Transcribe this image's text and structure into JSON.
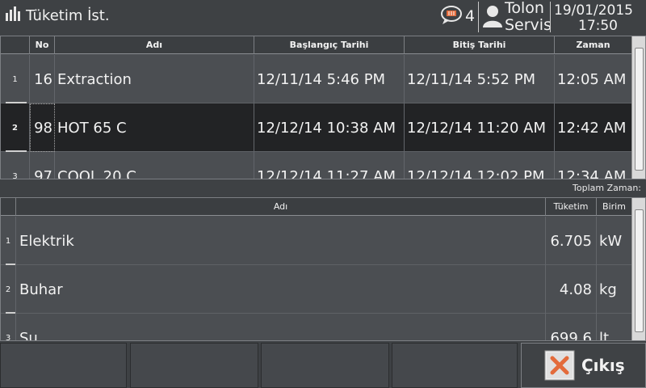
{
  "header": {
    "title": "Tüketim İst.",
    "message_count": "4",
    "user_line1": "Tolon",
    "user_line2": "Servis",
    "date": "19/01/2015",
    "time": "17:50"
  },
  "process_table": {
    "columns": [
      "No",
      "Adı",
      "Başlangıç Tarihi",
      "Bitiş Tarihi",
      "Zaman"
    ],
    "rows": [
      {
        "index": "1",
        "no": "16",
        "name": "Extraction",
        "start": "12/11/14 5:46 PM",
        "end": "12/11/14 5:52 PM",
        "duration": "12:05 AM"
      },
      {
        "index": "2",
        "no": "98",
        "name": "HOT 65 C",
        "start": "12/12/14 10:38 AM",
        "end": "12/12/14 11:20 AM",
        "duration": "12:42 AM"
      },
      {
        "index": "3",
        "no": "97",
        "name": "COOL 20 C",
        "start": "12/12/14 11:27 AM",
        "end": "12/12/14 12:02 PM",
        "duration": "12:34 AM"
      }
    ],
    "selected_row": 2
  },
  "total_time_label": "Toplam Zaman:",
  "consumption_table": {
    "columns": [
      "Adı",
      "Tüketim",
      "Birim"
    ],
    "rows": [
      {
        "index": "1",
        "name": "Elektrik",
        "amount": "6.705",
        "unit": "kW"
      },
      {
        "index": "2",
        "name": "Buhar",
        "amount": "4.08",
        "unit": "kg"
      },
      {
        "index": "3",
        "name": "Su",
        "amount": "699.6",
        "unit": "lt"
      }
    ]
  },
  "footer": {
    "exit_label": "Çıkış"
  },
  "colors": {
    "background": "#3e4144",
    "selected_row": "#222325",
    "exit_icon": "#e36b3b"
  }
}
